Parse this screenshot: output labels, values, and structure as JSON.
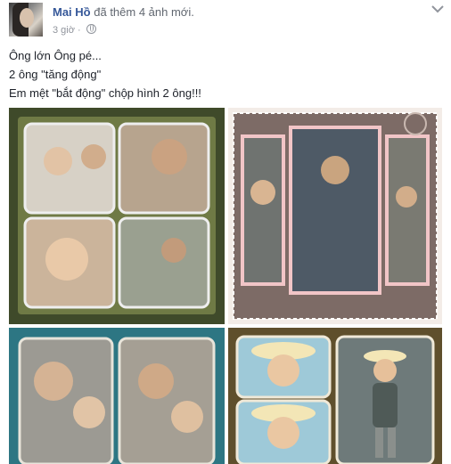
{
  "post": {
    "author": "Mai Hồ",
    "action": "đã thêm 4 ảnh mới.",
    "time": "3 giờ ·",
    "message_lines": [
      "Ông lớn Ông pé...",
      "2 ông \"tăng động\"",
      "Em mệt \"bắt động\" chộp hình 2 ông!!!"
    ]
  },
  "icons": {
    "avatar": "profile-avatar",
    "privacy": "globe-icon",
    "menu": "chevron-down-icon"
  },
  "photos": [
    {
      "name": "photo-1",
      "style": "collage-4-panels-green-frame",
      "accent": "#4a5330"
    },
    {
      "name": "photo-2",
      "style": "collage-3-panels-stamp-frame",
      "accent": "#7a6a66"
    },
    {
      "name": "photo-3",
      "style": "collage-2-panels-teal-frame",
      "accent": "#2a6f7a"
    },
    {
      "name": "photo-4",
      "style": "collage-3-panels-gold-frame",
      "accent": "#6b5a33"
    }
  ],
  "colors": {
    "author_link": "#365899",
    "meta_text": "#90949c",
    "body_text": "#1d2129"
  }
}
